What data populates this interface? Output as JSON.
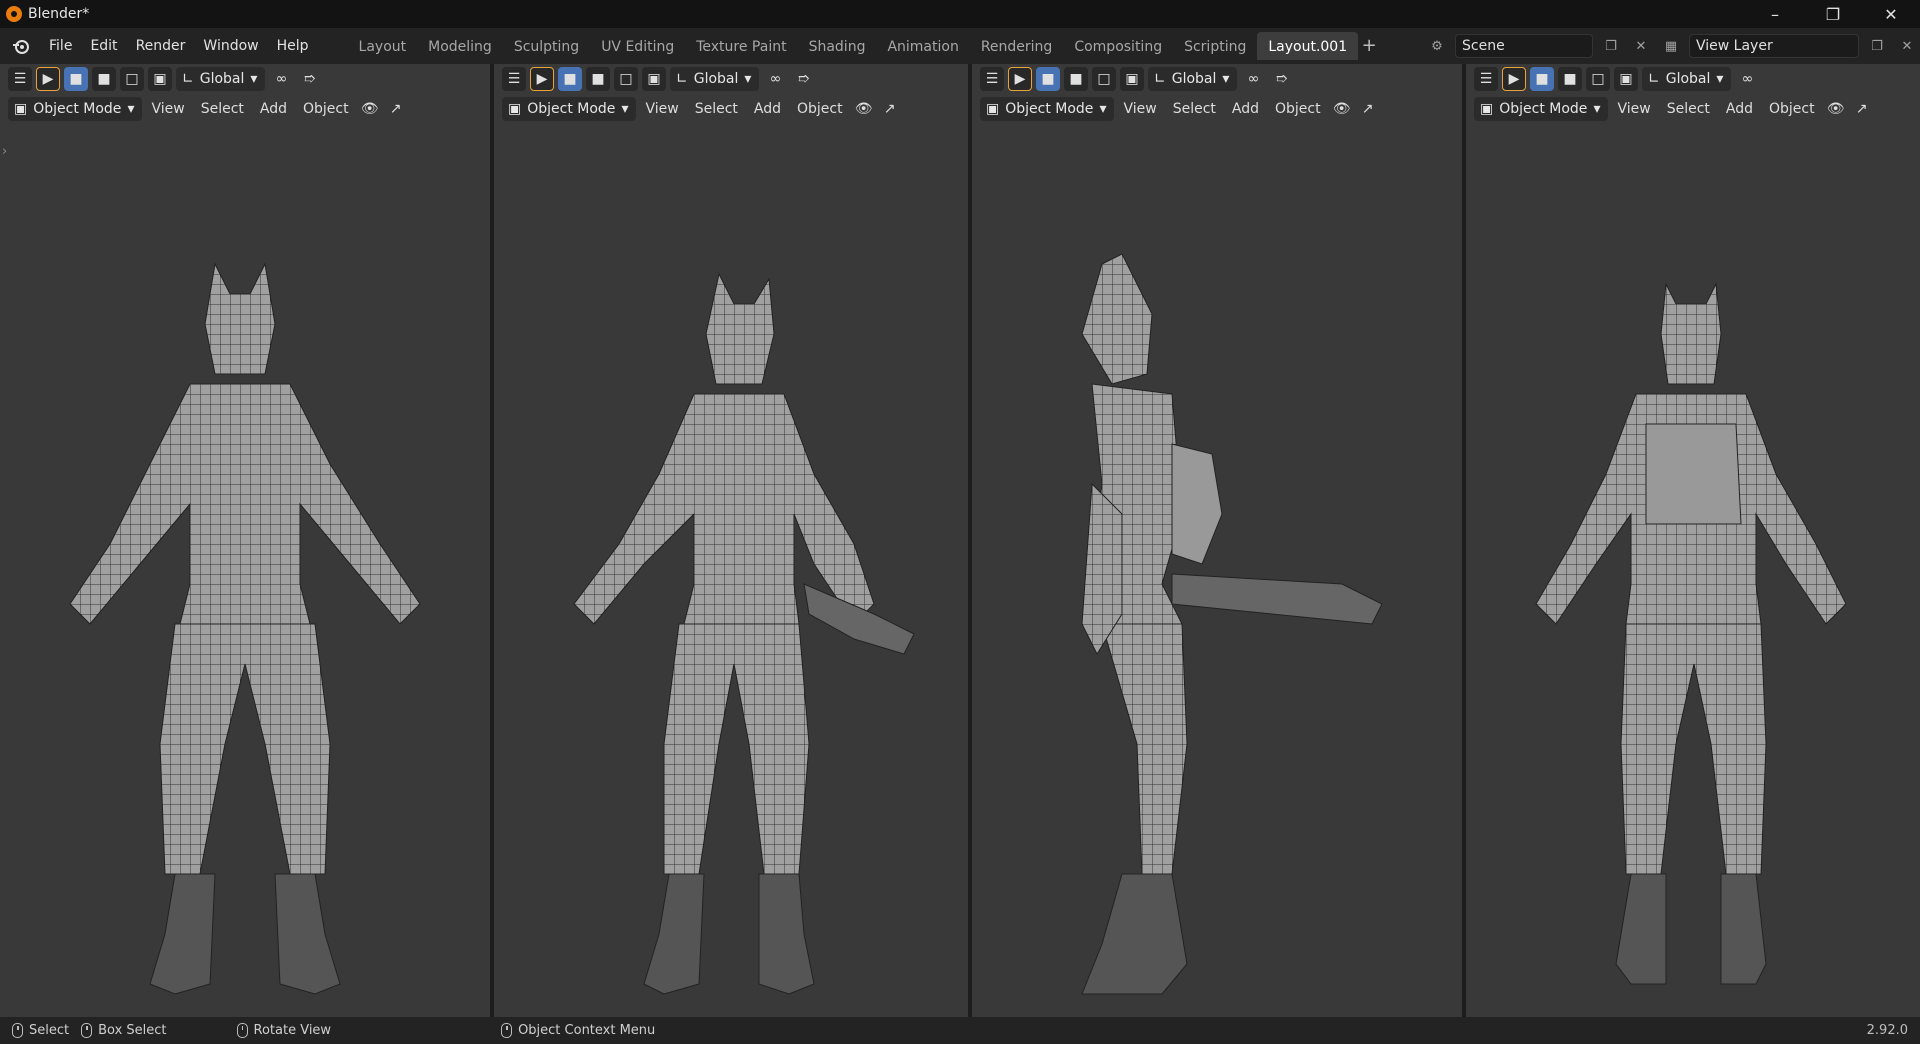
{
  "window": {
    "title": "Blender*"
  },
  "menu": {
    "items": [
      "File",
      "Edit",
      "Render",
      "Window",
      "Help"
    ]
  },
  "workspace_tabs": [
    {
      "label": "Layout"
    },
    {
      "label": "Modeling"
    },
    {
      "label": "Sculpting"
    },
    {
      "label": "UV Editing"
    },
    {
      "label": "Texture Paint"
    },
    {
      "label": "Shading"
    },
    {
      "label": "Animation"
    },
    {
      "label": "Rendering"
    },
    {
      "label": "Compositing"
    },
    {
      "label": "Scripting"
    },
    {
      "label": "Layout.001",
      "active": true
    }
  ],
  "scene": {
    "name": "Scene",
    "view_layer": "View Layer"
  },
  "viewport_header": {
    "transform_orientation": "Global",
    "mode": "Object Mode",
    "menus": [
      "View",
      "Select",
      "Add",
      "Object"
    ]
  },
  "viewports": [
    {
      "view": "front"
    },
    {
      "view": "three-quarter"
    },
    {
      "view": "side"
    },
    {
      "view": "back"
    }
  ],
  "statusbar": {
    "select": "Select",
    "box_select": "Box Select",
    "rotate_view": "Rotate View",
    "context_menu": "Object Context Menu",
    "version": "2.92.0"
  },
  "colors": {
    "accent": "#4772b3",
    "active_tool": "#e8a43a",
    "viewport_bg": "#393939",
    "logo": "#e87d0d"
  }
}
